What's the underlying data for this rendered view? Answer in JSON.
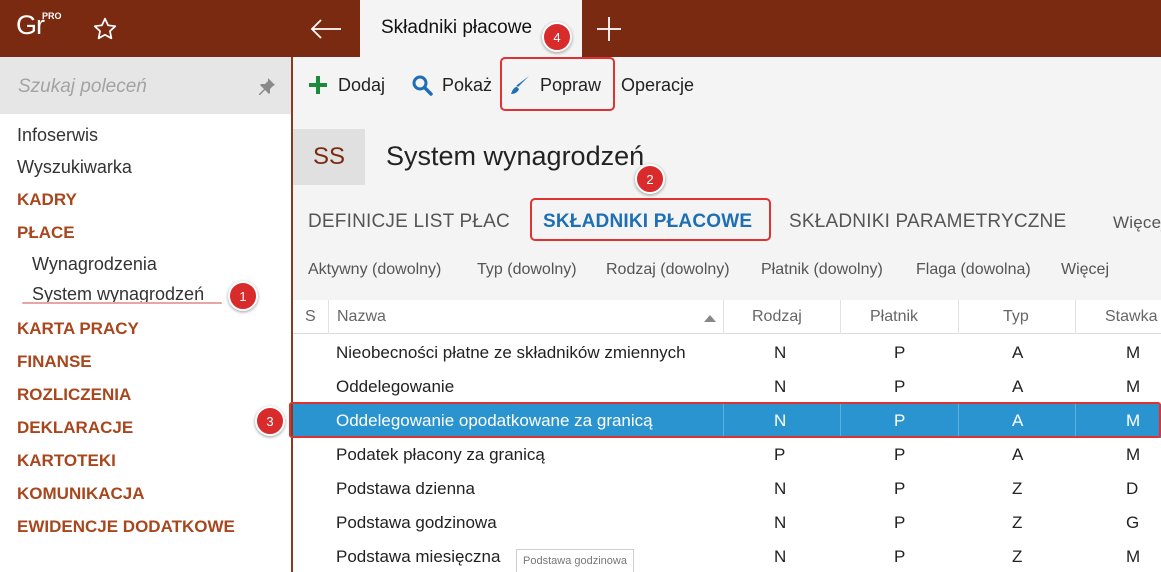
{
  "app": {
    "logo_text": "Gr",
    "logo_badge": "PRO",
    "active_tab_title": "Składniki płacowe",
    "brand_color": "#7a2a10"
  },
  "sidebar": {
    "search_placeholder": "Szukaj poleceń",
    "items": [
      {
        "label": "Infoserwis",
        "kind": "plain"
      },
      {
        "label": "Wyszukiwarka",
        "kind": "plain"
      },
      {
        "label": "KADRY",
        "kind": "section"
      },
      {
        "label": "PŁACE",
        "kind": "section"
      },
      {
        "label": "Wynagrodzenia",
        "kind": "sub"
      },
      {
        "label": "System wynagrodzeń",
        "kind": "sub"
      },
      {
        "label": "KARTA PRACY",
        "kind": "section"
      },
      {
        "label": "FINANSE",
        "kind": "section"
      },
      {
        "label": "ROZLICZENIA",
        "kind": "section"
      },
      {
        "label": "DEKLARACJE",
        "kind": "section"
      },
      {
        "label": "KARTOTEKI",
        "kind": "section"
      },
      {
        "label": "KOMUNIKACJA",
        "kind": "section"
      },
      {
        "label": "EWIDENCJE DODATKOWE",
        "kind": "section"
      }
    ]
  },
  "toolbar": {
    "add": "Dodaj",
    "show": "Pokaż",
    "edit": "Popraw",
    "operations": "Operacje"
  },
  "header": {
    "badge": "SS",
    "title": "System wynagrodzeń"
  },
  "tabs": [
    {
      "label": "DEFINICJE LIST PŁAC",
      "active": false
    },
    {
      "label": "SKŁADNIKI PŁACOWE",
      "active": true
    },
    {
      "label": "SKŁADNIKI PARAMETRYCZNE",
      "active": false
    },
    {
      "label": "Więcej",
      "active": false
    }
  ],
  "filters": [
    "Aktywny (dowolny)",
    "Typ (dowolny)",
    "Rodzaj (dowolny)",
    "Płatnik (dowolny)",
    "Flaga (dowolna)",
    "Więcej"
  ],
  "grid": {
    "columns": [
      "S",
      "Nazwa",
      "Rodzaj",
      "Płatnik",
      "Typ",
      "Stawka"
    ],
    "sort_column": "Nazwa",
    "sort_direction": "ascending",
    "rows": [
      {
        "nazwa": "Nieobecności płatne ze składników zmiennych",
        "rodzaj": "N",
        "platnik": "P",
        "typ": "A",
        "stawka": "M",
        "selected": false
      },
      {
        "nazwa": "Oddelegowanie",
        "rodzaj": "N",
        "platnik": "P",
        "typ": "A",
        "stawka": "M",
        "selected": false
      },
      {
        "nazwa": "Oddelegowanie opodatkowane za granicą",
        "rodzaj": "N",
        "platnik": "P",
        "typ": "A",
        "stawka": "M",
        "selected": true
      },
      {
        "nazwa": "Podatek płacony za granicą",
        "rodzaj": "P",
        "platnik": "P",
        "typ": "A",
        "stawka": "M",
        "selected": false
      },
      {
        "nazwa": "Podstawa dzienna",
        "rodzaj": "N",
        "platnik": "P",
        "typ": "Z",
        "stawka": "D",
        "selected": false
      },
      {
        "nazwa": "Podstawa godzinowa",
        "rodzaj": "N",
        "platnik": "P",
        "typ": "Z",
        "stawka": "G",
        "selected": false
      },
      {
        "nazwa": "Podstawa miesięczna",
        "rodzaj": "N",
        "platnik": "P",
        "typ": "Z",
        "stawka": "M",
        "selected": false
      }
    ],
    "tooltip": "Podstawa godzinowa",
    "selection_color": "#2a94d0"
  },
  "annotations": [
    "1",
    "2",
    "3",
    "4"
  ],
  "annotation_color": "#d92b2b"
}
